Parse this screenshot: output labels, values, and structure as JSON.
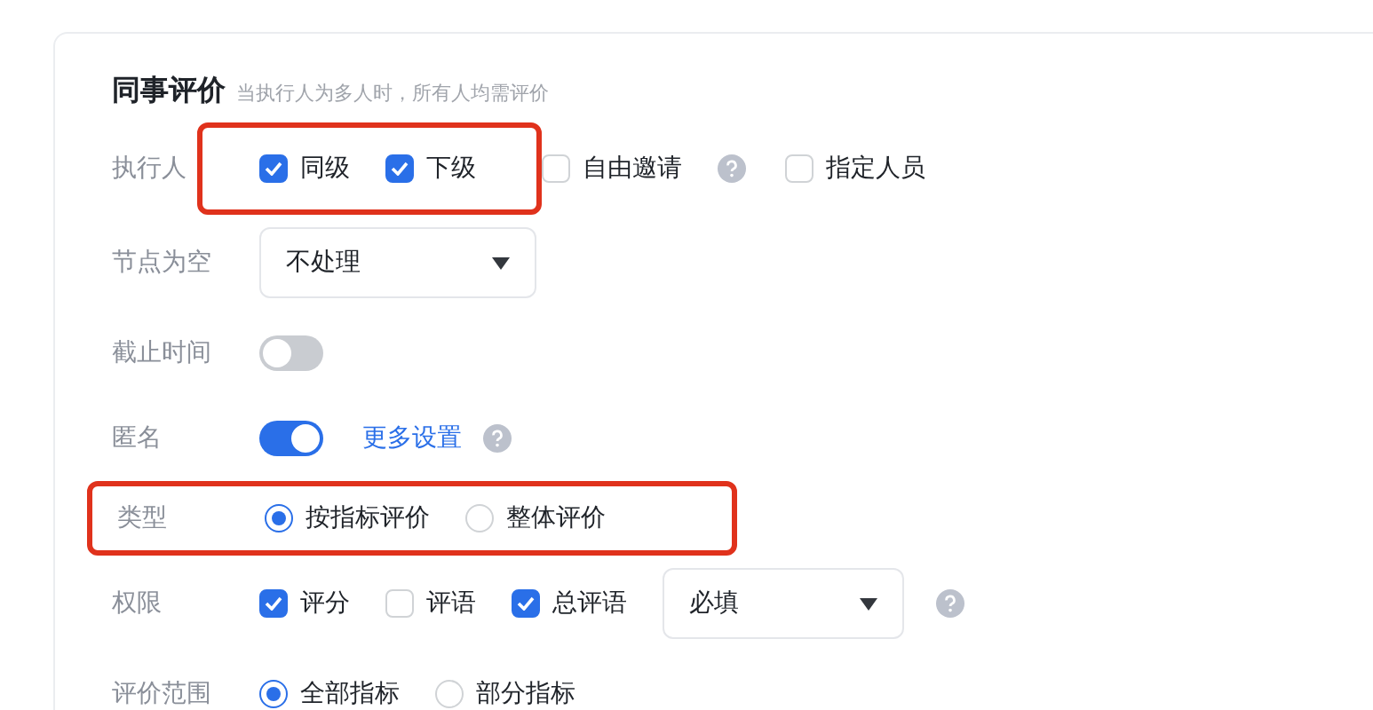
{
  "section": {
    "title": "同事评价",
    "hint": "当执行人为多人时，所有人均需评价"
  },
  "rows": [
    {
      "label": "执行人",
      "highlighted": false,
      "items": [
        {
          "kind": "checkbox",
          "label": "同级",
          "checked": true,
          "highlighted": true
        },
        {
          "kind": "checkbox",
          "label": "下级",
          "checked": true,
          "highlighted": true
        },
        {
          "kind": "checkbox",
          "label": "自由邀请",
          "checked": false,
          "highlighted": false
        },
        {
          "kind": "help"
        },
        {
          "kind": "checkbox",
          "label": "指定人员",
          "checked": false,
          "highlighted": false
        }
      ]
    },
    {
      "label": "节点为空",
      "highlighted": false,
      "items": [
        {
          "kind": "select",
          "value": "不处理"
        }
      ]
    },
    {
      "label": "截止时间",
      "highlighted": false,
      "items": [
        {
          "kind": "switch",
          "on": false
        }
      ]
    },
    {
      "label": "匿名",
      "highlighted": false,
      "items": [
        {
          "kind": "switch",
          "on": true
        },
        {
          "kind": "link",
          "label": "更多设置"
        },
        {
          "kind": "help"
        }
      ]
    },
    {
      "label": "类型",
      "highlighted": true,
      "items": [
        {
          "kind": "radio",
          "label": "按指标评价",
          "selected": true
        },
        {
          "kind": "radio",
          "label": "整体评价",
          "selected": false
        }
      ]
    },
    {
      "label": "权限",
      "highlighted": false,
      "items": [
        {
          "kind": "checkbox",
          "label": "评分",
          "checked": true
        },
        {
          "kind": "checkbox",
          "label": "评语",
          "checked": false
        },
        {
          "kind": "checkbox",
          "label": "总评语",
          "checked": true
        },
        {
          "kind": "select",
          "value": "必填"
        },
        {
          "kind": "help"
        }
      ]
    },
    {
      "label": "评价范围",
      "highlighted": false,
      "items": [
        {
          "kind": "radio",
          "label": "全部指标",
          "selected": true
        },
        {
          "kind": "radio",
          "label": "部分指标",
          "selected": false
        }
      ]
    }
  ]
}
